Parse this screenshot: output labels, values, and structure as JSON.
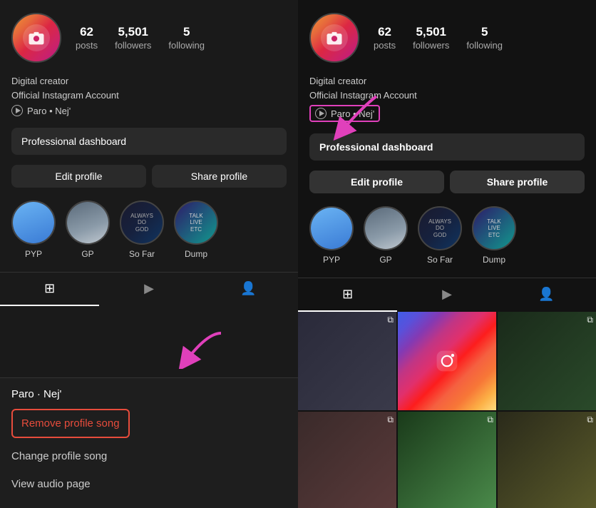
{
  "left": {
    "stats": {
      "posts_count": "62",
      "posts_label": "posts",
      "followers_count": "5,501",
      "followers_label": "followers",
      "following_count": "5",
      "following_label": "following"
    },
    "bio": {
      "line1": "Digital creator",
      "line2": "Official Instagram Account",
      "link_text": "Paro • Nej'"
    },
    "dashboard_label": "Professional dashboard",
    "edit_btn": "Edit profile",
    "share_btn": "Share profile",
    "highlights": [
      {
        "label": "PYP"
      },
      {
        "label": "GP"
      },
      {
        "label": "So Far"
      },
      {
        "label": "Dump"
      }
    ],
    "bottom_sheet": {
      "song_title": "Paro · Nej'",
      "remove_label": "Remove profile song",
      "change_label": "Change profile song",
      "view_label": "View audio page"
    }
  },
  "right": {
    "stats": {
      "posts_count": "62",
      "posts_label": "posts",
      "followers_count": "5,501",
      "followers_label": "followers",
      "following_count": "5",
      "following_label": "following"
    },
    "bio": {
      "line1": "Digital creator",
      "line2": "Official Instagram Account",
      "link_text": "Paro • Nej'"
    },
    "dashboard_label": "Professional dashboard",
    "edit_btn": "Edit profile",
    "share_btn": "Share profile",
    "highlights": [
      {
        "label": "PYP"
      },
      {
        "label": "GP"
      },
      {
        "label": "So Far"
      },
      {
        "label": "Dump"
      }
    ]
  }
}
